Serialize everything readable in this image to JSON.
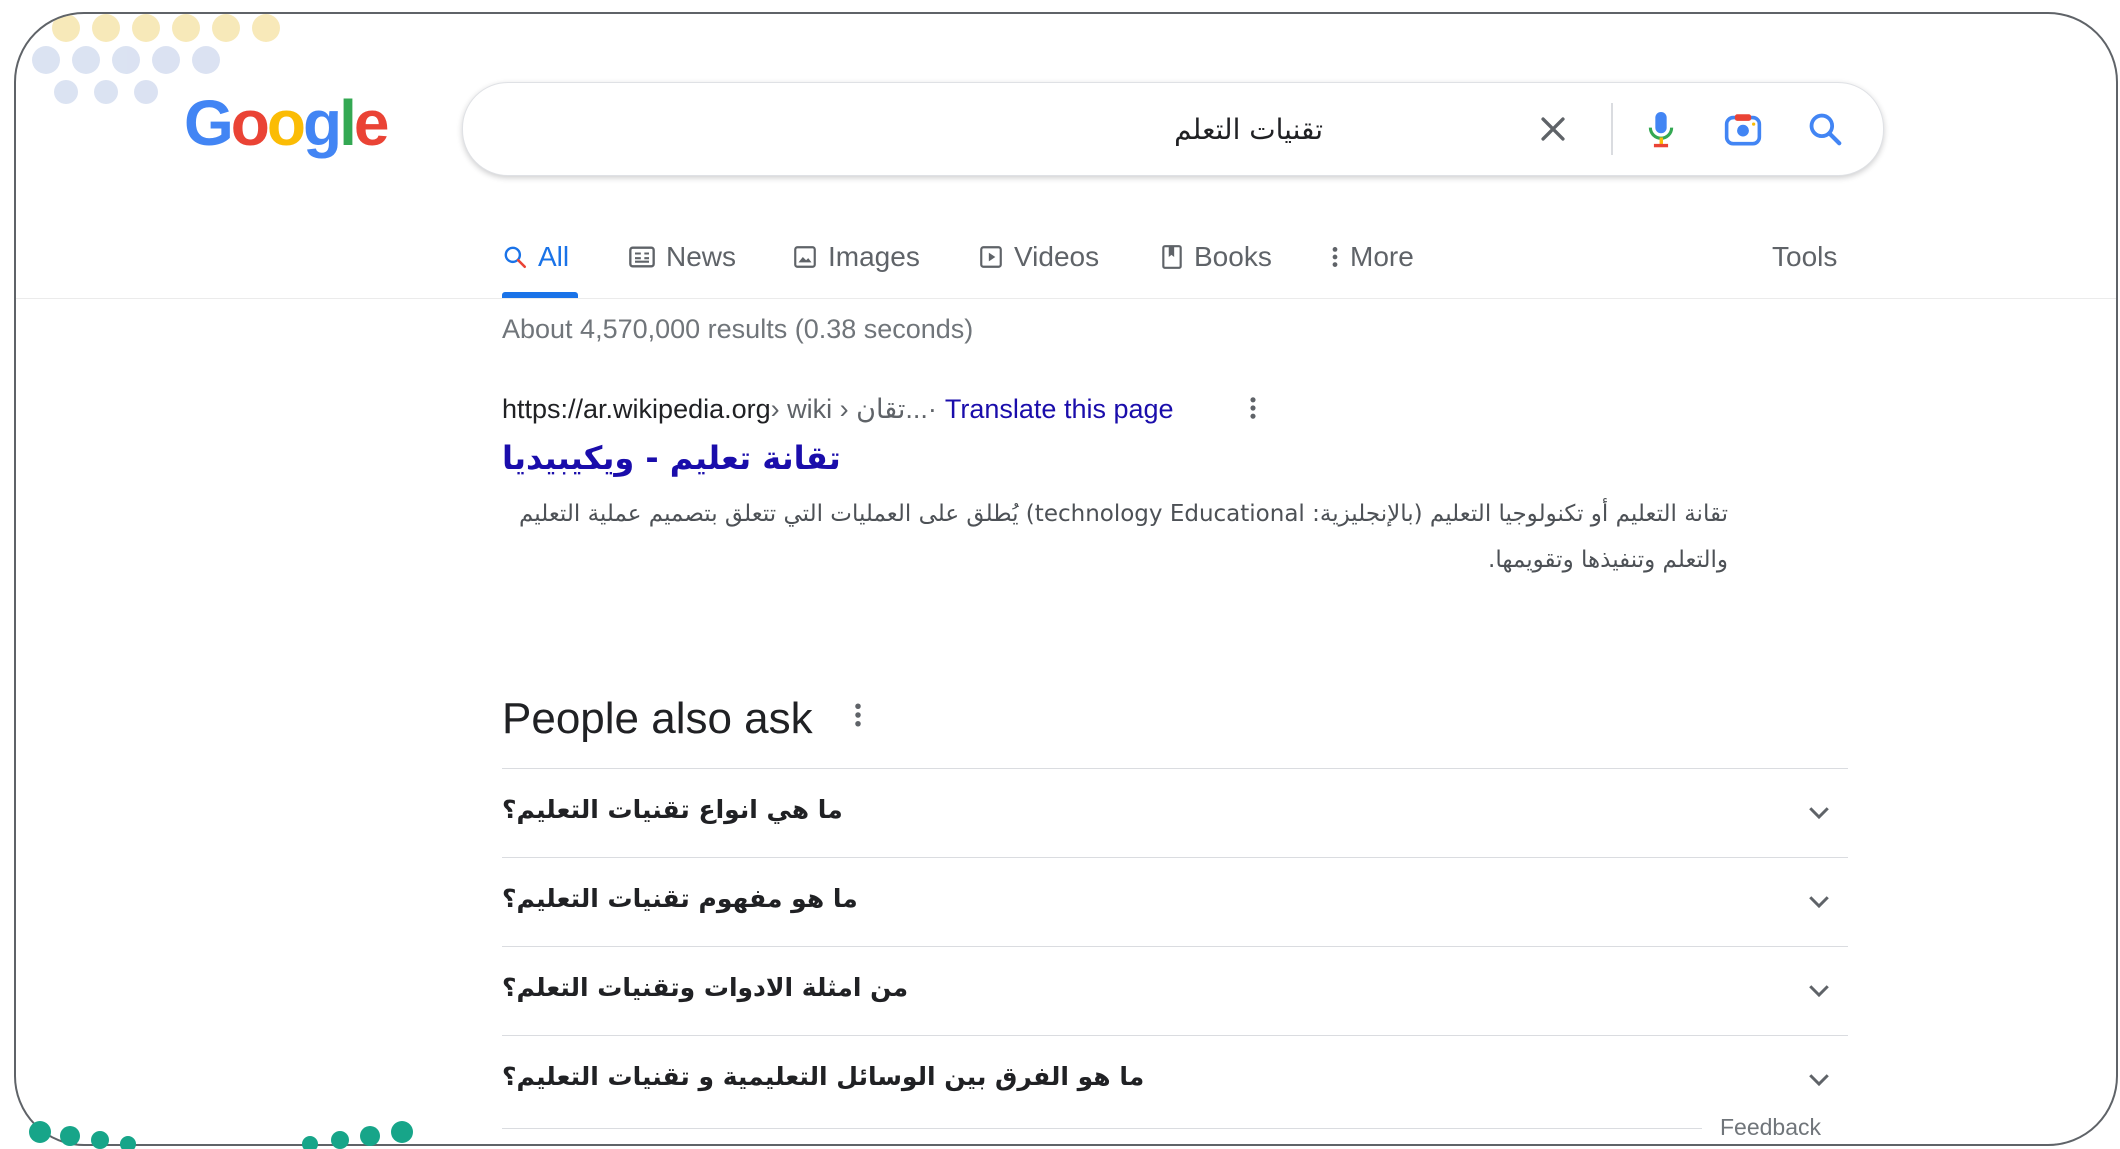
{
  "brand": {
    "logo_letters": [
      "G",
      "o",
      "o",
      "g",
      "l",
      "e"
    ],
    "logo_colors": [
      "#4285f4",
      "#ea4335",
      "#fbbc05",
      "#4285f4",
      "#34a853",
      "#ea4335"
    ],
    "accent": "#1a73e8",
    "link_color": "#1a0dab"
  },
  "search": {
    "query": "تقنيات التعلم",
    "icons": [
      "close-icon",
      "mic-icon",
      "lens-icon",
      "search-icon"
    ]
  },
  "tabs": [
    {
      "label": "All",
      "icon": "search-icon",
      "active": true
    },
    {
      "label": "News",
      "icon": "news-icon",
      "active": false
    },
    {
      "label": "Images",
      "icon": "image-icon",
      "active": false
    },
    {
      "label": "Videos",
      "icon": "video-icon",
      "active": false
    },
    {
      "label": "Books",
      "icon": "book-icon",
      "active": false
    },
    {
      "label": "More",
      "icon": "more-vertical-icon",
      "active": false
    }
  ],
  "tools_label": "Tools",
  "results_stats": "About 4,570,000 results (0.38 seconds)",
  "result": {
    "url_host": "https://ar.wikipedia.org",
    "url_path": " › wiki › تقان... ",
    "separator": "·",
    "translate": "Translate this page",
    "title": "تقانة تعليم - ويكيبيديا",
    "snippet_line1": "تقانة التعليم أو تكنولوجيا التعليم (بالإنجليزية: technology Educational) يُطلق على العمليات التي تتعلق بتصميم عملية التعليم",
    "snippet_line2": "والتعلم وتنفيذها وتقويمها."
  },
  "paa": {
    "heading": "People also ask",
    "questions": [
      "ما هي انواع تقنيات التعليم؟",
      "ما هو مفهوم تقنيات التعليم؟",
      "من امثلة الادوات وتقنيات التعلم؟",
      "ما هو الفرق بين الوسائل التعليمية و تقنيات التعليم؟"
    ]
  },
  "feedback_label": "Feedback"
}
